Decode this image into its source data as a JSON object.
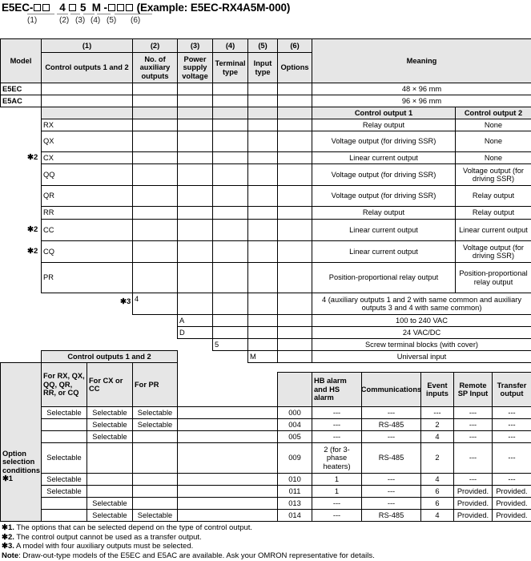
{
  "title": {
    "prefix": "E5EC-",
    "mid1": "4",
    "mid2": "5",
    "mid3": "M",
    "dash": "-",
    "example": "(Example: E5EC-RX4A5M-000)",
    "subs": [
      "(1)",
      "(2)",
      "(3)",
      "(4)",
      "(5)",
      "(6)"
    ]
  },
  "header": {
    "model": "Model",
    "nums": [
      "(1)",
      "(2)",
      "(3)",
      "(4)",
      "(5)",
      "(6)"
    ],
    "cols": [
      "Control outputs 1 and 2",
      "No. of auxiliary outputs",
      "Power supply voltage",
      "Terminal type",
      "Input type",
      "Options"
    ],
    "meaning": "Meaning"
  },
  "models": [
    {
      "model": "E5EC",
      "meaning": "48 × 96 mm"
    },
    {
      "model": "E5AC",
      "meaning": "96 × 96 mm"
    }
  ],
  "control_header": {
    "out1": "Control output 1",
    "out2": "Control output 2"
  },
  "control_outputs": [
    {
      "mark": "",
      "code": "RX",
      "out1": "Relay output",
      "out2": "None"
    },
    {
      "mark": "",
      "code": "QX",
      "out1": "Voltage output (for driving SSR)",
      "out2": "None"
    },
    {
      "mark": "✱2",
      "code": "CX",
      "out1": "Linear current output",
      "out2": "None"
    },
    {
      "mark": "",
      "code": "QQ",
      "out1": "Voltage output (for driving SSR)",
      "out2": "Voltage output (for driving SSR)"
    },
    {
      "mark": "",
      "code": "QR",
      "out1": "Voltage output (for driving SSR)",
      "out2": "Relay output"
    },
    {
      "mark": "",
      "code": "RR",
      "out1": "Relay output",
      "out2": "Relay output"
    },
    {
      "mark": "✱2",
      "code": "CC",
      "out1": "Linear current output",
      "out2": "Linear current output"
    },
    {
      "mark": "✱2",
      "code": "CQ",
      "out1": "Linear current output",
      "out2": "Voltage output (for driving SSR)"
    },
    {
      "mark": "",
      "code": "PR",
      "out1": "Position-proportional relay output",
      "out2": "Position-proportional relay output"
    }
  ],
  "aux": {
    "mark": "✱3",
    "code": "4",
    "meaning": "4 (auxiliary outputs 1 and 2 with same common and auxiliary outputs 3 and 4 with same common)"
  },
  "power": [
    {
      "code": "A",
      "meaning": "100 to 240 VAC"
    },
    {
      "code": "D",
      "meaning": "24 VAC/DC"
    }
  ],
  "terminal": {
    "code": "5",
    "meaning": "Screw terminal blocks (with cover)"
  },
  "input": {
    "code": "M",
    "meaning": "Universal input"
  },
  "options": {
    "group_label": "Control outputs 1 and 2",
    "side_label": "Option selection conditions ✱1",
    "cond_headers": [
      "For RX, QX, QQ, QR, RR, or CQ",
      "For CX or CC",
      "For PR"
    ],
    "opt_headers": [
      "HB alarm and HS alarm",
      "Communications",
      "Event inputs",
      "Remote SP Input",
      "Transfer output"
    ],
    "rows": [
      {
        "c1": "Selectable",
        "c2": "Selectable",
        "c3": "Selectable",
        "code": "000",
        "hb": "---",
        "comm": "---",
        "event": "---",
        "rsp": "---",
        "transfer": "---"
      },
      {
        "c1": "",
        "c2": "Selectable",
        "c3": "Selectable",
        "code": "004",
        "hb": "---",
        "comm": "RS-485",
        "event": "2",
        "rsp": "---",
        "transfer": "---"
      },
      {
        "c1": "",
        "c2": "Selectable",
        "c3": "",
        "code": "005",
        "hb": "---",
        "comm": "---",
        "event": "4",
        "rsp": "---",
        "transfer": "---"
      },
      {
        "c1": "Selectable",
        "c2": "",
        "c3": "",
        "code": "009",
        "hb": "2 (for 3-phase heaters)",
        "comm": "RS-485",
        "event": "2",
        "rsp": "---",
        "transfer": "---"
      },
      {
        "c1": "Selectable",
        "c2": "",
        "c3": "",
        "code": "010",
        "hb": "1",
        "comm": "---",
        "event": "4",
        "rsp": "---",
        "transfer": "---"
      },
      {
        "c1": "Selectable",
        "c2": "",
        "c3": "",
        "code": "011",
        "hb": "1",
        "comm": "---",
        "event": "6",
        "rsp": "Provided.",
        "transfer": "Provided."
      },
      {
        "c1": "",
        "c2": "Selectable",
        "c3": "",
        "code": "013",
        "hb": "---",
        "comm": "---",
        "event": "6",
        "rsp": "Provided.",
        "transfer": "Provided."
      },
      {
        "c1": "",
        "c2": "Selectable",
        "c3": "Selectable",
        "code": "014",
        "hb": "---",
        "comm": "RS-485",
        "event": "4",
        "rsp": "Provided.",
        "transfer": "Provided."
      }
    ]
  },
  "footnotes": [
    {
      "mark": "✱1.",
      "text": " The options that can be selected depend on the type of control output."
    },
    {
      "mark": "✱2.",
      "text": " The control output cannot be used as a transfer output."
    },
    {
      "mark": "✱3.",
      "text": " A model with four auxiliary outputs must be selected."
    },
    {
      "mark": "Note",
      "text": ": Draw-out-type models of the E5EC and E5AC are available. Ask your OMRON representative for details."
    }
  ]
}
